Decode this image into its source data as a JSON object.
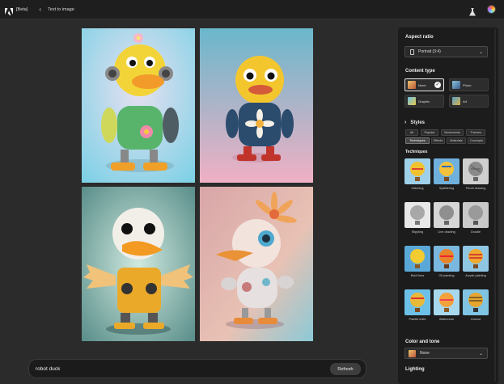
{
  "header": {
    "brand": "[Beta]",
    "breadcrumb": "Text to image",
    "back_icon": "‹"
  },
  "prompt": {
    "value": "robot duck",
    "refresh_label": "Refresh"
  },
  "panel": {
    "aspect_ratio": {
      "title": "Aspect ratio",
      "value": "Portrait (3:4)"
    },
    "content_type": {
      "title": "Content type",
      "options": [
        {
          "label": "None",
          "selected": true
        },
        {
          "label": "Photo",
          "selected": false
        },
        {
          "label": "Graphic",
          "selected": false
        },
        {
          "label": "Art",
          "selected": false
        }
      ]
    },
    "styles": {
      "title": "Styles",
      "chips": [
        "All",
        "Popular",
        "Movements",
        "Themes",
        "Techniques",
        "Effects",
        "Materials",
        "Concepts"
      ],
      "active_chip": "Techniques"
    },
    "techniques": {
      "title": "Techniques",
      "items": [
        "Hatching",
        "Splattering",
        "Pencil drawing",
        "Stippling",
        "Line drawing",
        "Doodle",
        "Bold lines",
        "Oil painting",
        "Acrylic painting",
        "Palette knife",
        "Watercolor",
        "Linocut"
      ]
    },
    "color_tone": {
      "title": "Color and tone",
      "value": "None"
    },
    "lighting": {
      "title": "Lighting"
    }
  },
  "colors": {
    "accent_border": "#e8e8e8",
    "panel_bg": "#1c1c1c",
    "app_bg": "#2b2b2b"
  }
}
